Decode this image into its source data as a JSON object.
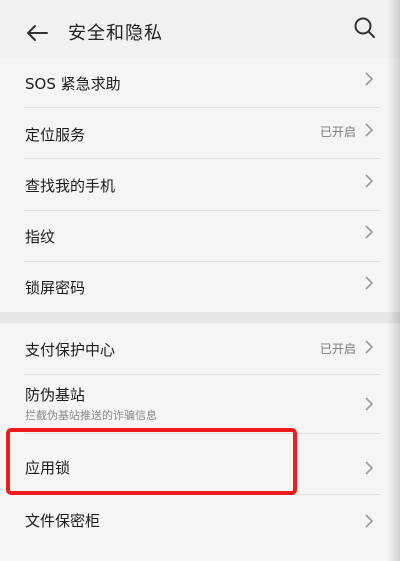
{
  "header": {
    "title": "安全和隐私",
    "back_icon": "back-arrow-icon",
    "search_icon": "search-icon"
  },
  "items": [
    {
      "label": "SOS 紧急求助"
    },
    {
      "label": "定位服务",
      "value": "已开启"
    },
    {
      "label": "查找我的手机"
    },
    {
      "label": "指纹"
    },
    {
      "label": "锁屏密码"
    },
    {
      "label": "支付保护中心",
      "value": "已开启"
    },
    {
      "label": "防伪基站",
      "sublabel": "拦截伪基站推送的诈骗信息"
    },
    {
      "label": "应用锁"
    },
    {
      "label": "文件保密柜"
    }
  ],
  "colors": {
    "highlight": "#ee1c1c",
    "background": "#f1f1f1",
    "separator": "#e6e6e6"
  }
}
